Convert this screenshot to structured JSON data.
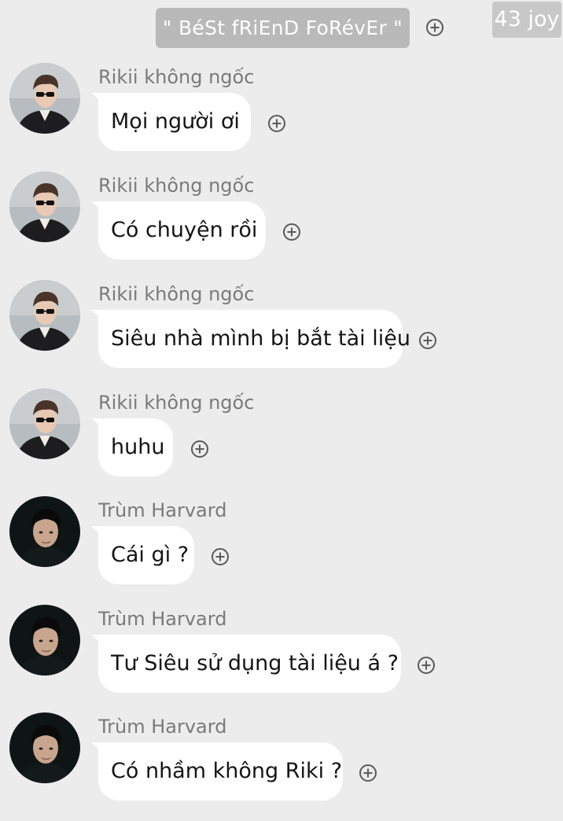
{
  "header": {
    "group_name": "\" BéSt fRiEnD FoRévEr \"",
    "count_label": "43 joy"
  },
  "messages": [
    {
      "sender": "Rikii không ngốc",
      "text": "Mọi người ơi",
      "avatar": "rikii"
    },
    {
      "sender": "Rikii không ngốc",
      "text": "Có chuyện rồi",
      "avatar": "rikii"
    },
    {
      "sender": "Rikii không ngốc",
      "text": "Siêu nhà mình bị bắt tài liệu",
      "avatar": "rikii"
    },
    {
      "sender": "Rikii không ngốc",
      "text": "huhu",
      "avatar": "rikii"
    },
    {
      "sender": "Trùm Harvard",
      "text": "Cái gì ?",
      "avatar": "harvard"
    },
    {
      "sender": "Trùm Harvard",
      "text": "Tư Siêu sử dụng tài liệu á ?",
      "avatar": "harvard"
    },
    {
      "sender": "Trùm Harvard",
      "text": "Có nhầm không Riki ?",
      "avatar": "harvard"
    }
  ],
  "colors": {
    "background": "#ececec",
    "bubble": "#ffffff",
    "title_pill": "#b9b9b9",
    "count_pill": "#c8c8c8",
    "sender_text": "#7a7a7a"
  }
}
